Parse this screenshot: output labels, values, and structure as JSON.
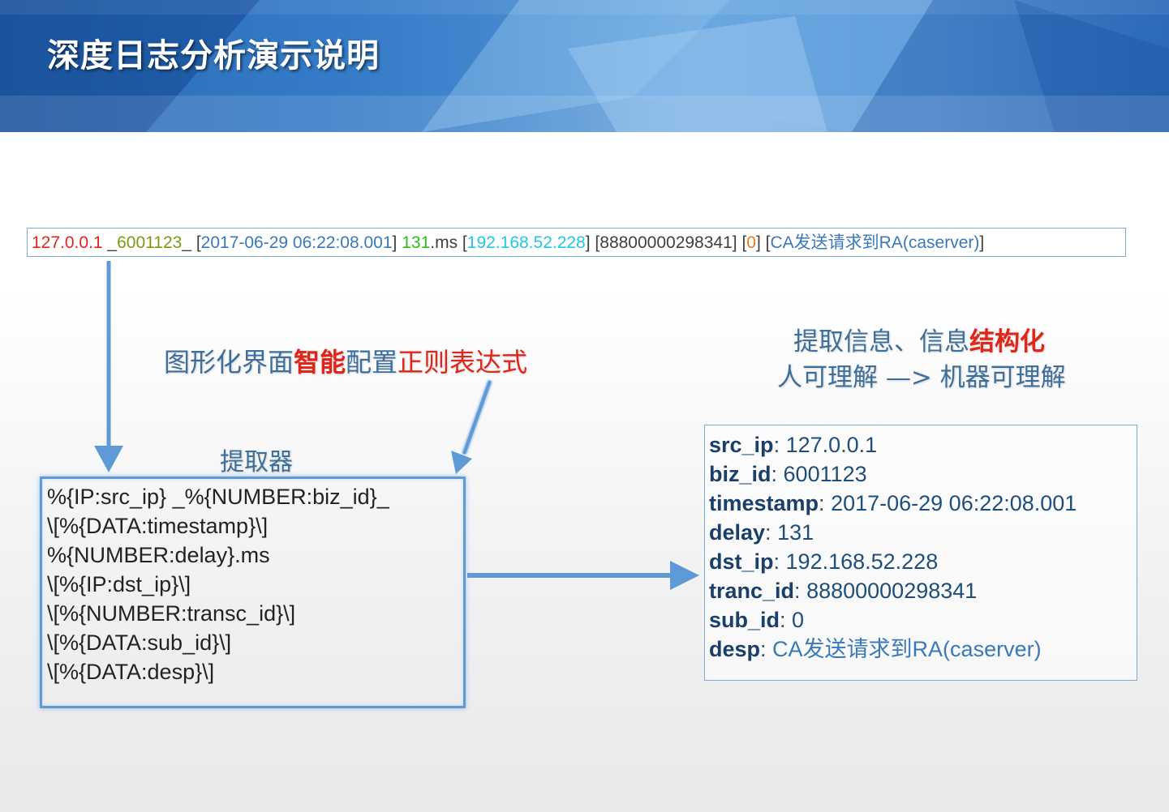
{
  "title": "深度日志分析演示说明",
  "log_line": {
    "parts": [
      {
        "text": "127.0.0.1",
        "color": "#e0261a"
      },
      {
        "text": " _",
        "color": "#404040"
      },
      {
        "text": "6001123",
        "color": "#7a9a14"
      },
      {
        "text": "_ [",
        "color": "#404040"
      },
      {
        "text": "2017-06-29 06:22:08.001",
        "color": "#3a79b8"
      },
      {
        "text": "] ",
        "color": "#404040"
      },
      {
        "text": "131",
        "color": "#2cbf1a"
      },
      {
        "text": ".ms [",
        "color": "#404040"
      },
      {
        "text": "192.168.52.228",
        "color": "#21c8e0"
      },
      {
        "text": "] [",
        "color": "#404040"
      },
      {
        "text": "88800000298341",
        "color": "#404040"
      },
      {
        "text": "] [",
        "color": "#404040"
      },
      {
        "text": "0",
        "color": "#ee7a1a"
      },
      {
        "text": "] [",
        "color": "#404040"
      },
      {
        "text": "CA发送请求到RA(caserver)",
        "color": "#3a79b8"
      },
      {
        "text": "]",
        "color": "#404040"
      }
    ]
  },
  "caption_regex": {
    "pre": "图形化界面",
    "highlight1": "智能",
    "mid": "配置",
    "highlight2": "正则表达式"
  },
  "caption_info": {
    "line1_pre": "提取信息、信息",
    "line1_highlight": "结构化",
    "line2": "人可理解 —> 机器可理解"
  },
  "extractor_label": "提取器",
  "patterns": [
    "%{IP:src_ip} _%{NUMBER:biz_id}_",
    "\\[%{DATA:timestamp}\\]",
    "%{NUMBER:delay}.ms",
    "\\[%{IP:dst_ip}\\]",
    "\\[%{NUMBER:transc_id}\\]",
    "\\[%{DATA:sub_id}\\]",
    "\\[%{DATA:desp}\\]"
  ],
  "fields": [
    {
      "key": "src_ip",
      "value": "127.0.0.1"
    },
    {
      "key": "biz_id",
      "value": "6001123"
    },
    {
      "key": "timestamp",
      "value": "2017-06-29 06:22:08.001"
    },
    {
      "key": "delay",
      "value": "131"
    },
    {
      "key": "dst_ip",
      "value": "192.168.52.228"
    },
    {
      "key": "tranc_id",
      "value": "88800000298341"
    },
    {
      "key": "sub_id",
      "value": "0"
    },
    {
      "key": "desp",
      "value": "CA发送请求到RA(caserver)"
    }
  ],
  "colors": {
    "header_blue": "#2f76c4",
    "highlight_red": "#e0261a",
    "caption_blue": "#3e6f9a",
    "arrow_blue": "#5e9ad6"
  }
}
